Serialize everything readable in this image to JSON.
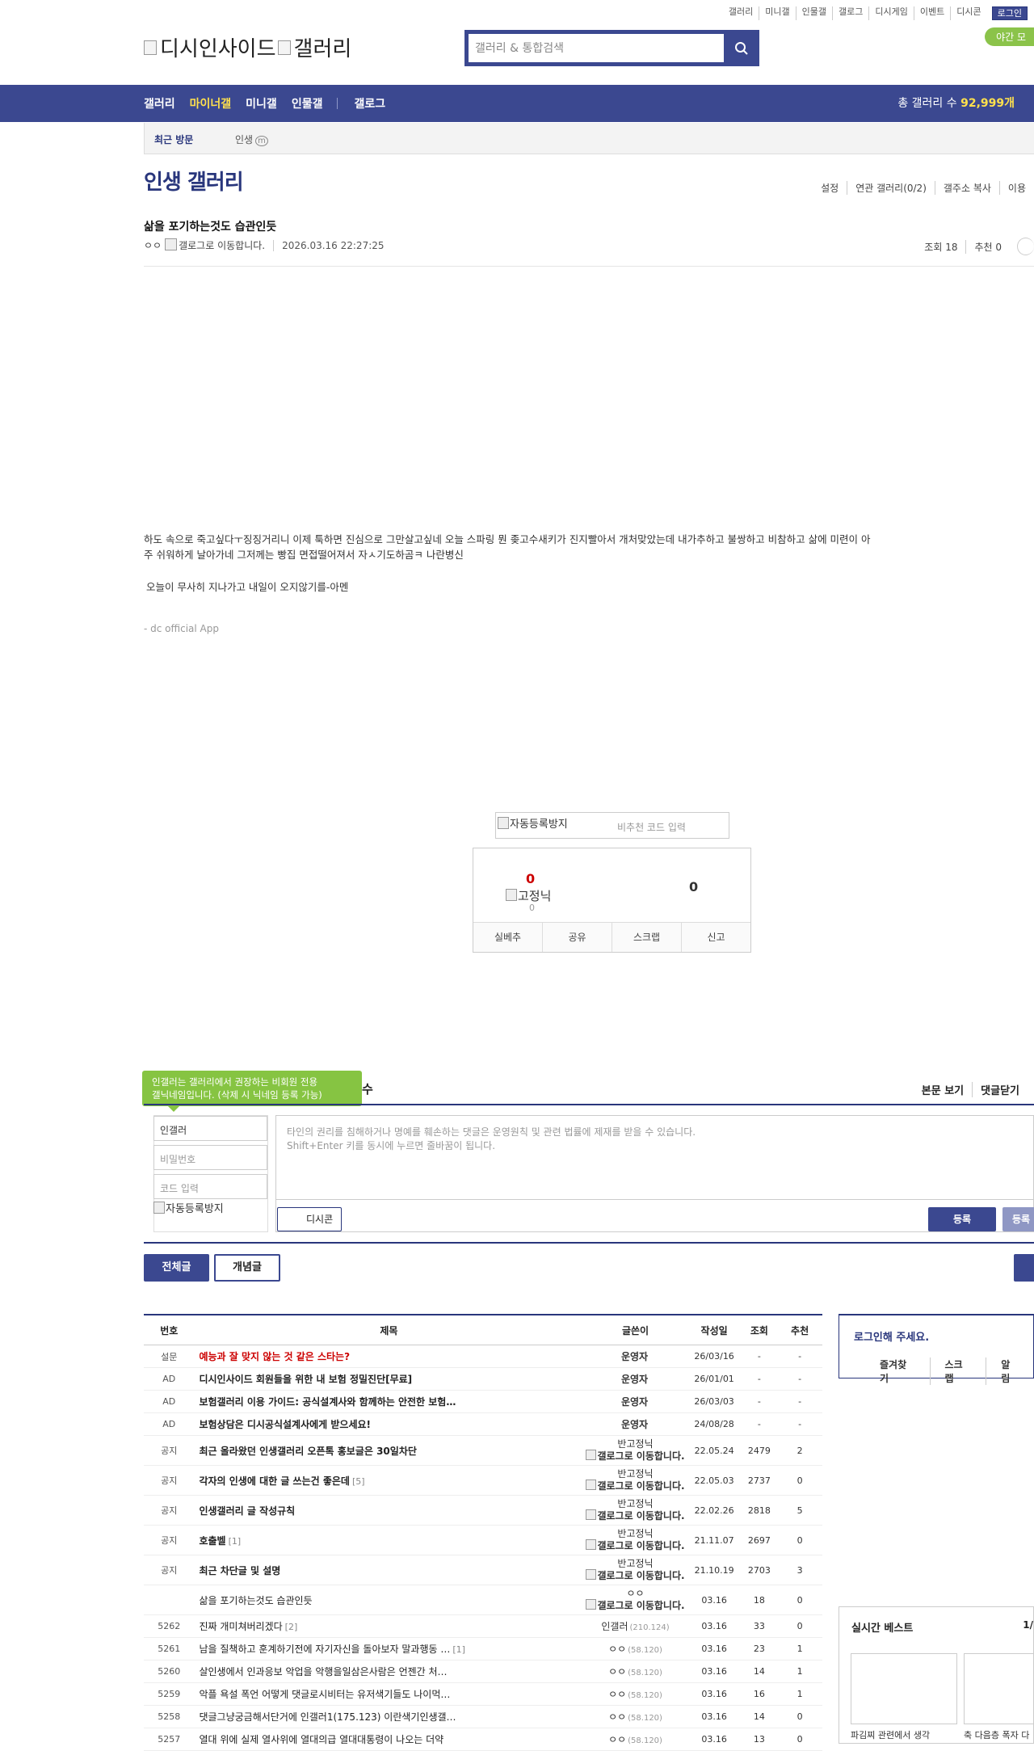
{
  "util_links": [
    "갤러리",
    "미니갤",
    "인물갤",
    "갤로그",
    "디시게임",
    "이벤트",
    "디시콘"
  ],
  "login": "로그인",
  "night_mode": "야간 모",
  "logo": {
    "brand": "디시인사이드",
    "section": "갤러리"
  },
  "search": {
    "placeholder": "갤러리 & 통합검색"
  },
  "nav": {
    "items": [
      "갤러리",
      "마이너갤",
      "미니갤",
      "인물갤",
      "갤로그"
    ],
    "total_label": "총 갤러리 수",
    "total_count": "92,999개"
  },
  "recent": {
    "label": "최근 방문",
    "item": "인생",
    "badge": "m"
  },
  "gallery": {
    "title": "인생 갤러리",
    "menu": [
      "설정",
      "연관 갤러리(0/2)",
      "갤주소 복사",
      "이용"
    ]
  },
  "post": {
    "title": "삶을 포기하는것도 습관인듯",
    "author": "ㅇㅇ",
    "gallog_alt": "갤로그로 이동합니다.",
    "date": "2026.03.16 22:27:25",
    "views": "조회 18",
    "recommend": "추천 0",
    "body1": "하도 속으로 죽고싶다ㅜ징징거리니 이제 툭하면 진심으로 그만살고싶네 오늘 스파링 뭔 좆고수새키가 진지빨아서 개처맞았는데 내가추하고 불쌍하고 비참하고 삶에 미련이 아주 쉬워하게 날아가네 그저께는 빵집 면접떨어져서 자ㅅ기도하곰ㅋ 나란병신",
    "body2": "오늘이 무사히 지나가고 내일이 오지않기를-아멘",
    "signature": "- dc official App"
  },
  "captcha": {
    "img_alt": "자동등록방지",
    "placeholder": "비추천 코드 입력"
  },
  "vote": {
    "up": "0",
    "fixed_nick_alt": "고정닉",
    "fixed_count": "0",
    "down": "0",
    "actions": [
      "실베추",
      "공유",
      "스크랩",
      "신고"
    ]
  },
  "comment": {
    "tooltip_line1": "인갤러는 갤러리에서 권장하는 비회원 전용",
    "tooltip_line2": "갤닉네임입니다. (삭제 시 닉네임 등록 가능)",
    "tooltip_tail": "수",
    "links": [
      "본문 보기",
      "댓글닫기"
    ],
    "nick_value": "인갤러",
    "password_placeholder": "비밀번호",
    "code_placeholder": "코드 입력",
    "captcha_alt": "자동등록방지",
    "notice1": "타인의 권리를 침해하거나 명예를 훼손하는 댓글은 운영원칙 및 관련 법률에 제재를 받을 수 있습니다.",
    "notice2": "Shift+Enter 키를 동시에 누르면 줄바꿈이 됩니다.",
    "dccon": "디시콘",
    "submit": "등록",
    "submit2": "등록"
  },
  "tabs": {
    "all": "전체글",
    "concept": "개념글"
  },
  "list": {
    "headers": [
      "번호",
      "제목",
      "글쓴이",
      "작성일",
      "조회",
      "추천"
    ],
    "rows": [
      {
        "num": "설문",
        "title": "예능과 잘 맞지 않는 것 같은 스타는?",
        "cmt": "",
        "writer": "운영자",
        "ip": "",
        "date": "26/03/16",
        "views": "-",
        "rec": "-",
        "kind": "hot"
      },
      {
        "num": "AD",
        "title": "디시인사이드 회원들을 위한 내 보험 정밀진단[무료]",
        "cmt": "",
        "writer": "운영자",
        "ip": "",
        "date": "26/01/01",
        "views": "-",
        "rec": "-",
        "kind": "ad"
      },
      {
        "num": "AD",
        "title": "보험갤러리 이용 가이드: 공식설계사와 함께하는 안전한 보험…",
        "cmt": "",
        "writer": "운영자",
        "ip": "",
        "date": "26/03/03",
        "views": "-",
        "rec": "-",
        "kind": "ad"
      },
      {
        "num": "AD",
        "title": "보험상담은 디시공식설계사에게 받으세요!",
        "cmt": "",
        "writer": "운영자",
        "ip": "",
        "date": "24/08/28",
        "views": "-",
        "rec": "-",
        "kind": "ad"
      },
      {
        "num": "공지",
        "title": "최근 올라왔던 인생갤러리 오픈톡 홍보글은 30일차단",
        "cmt": "",
        "writer": "반고정닉",
        "ip": "",
        "date": "22.05.24",
        "views": "2479",
        "rec": "2",
        "kind": "notice"
      },
      {
        "num": "공지",
        "title": "각자의 인생에 대한 글 쓰는건 좋은데",
        "cmt": "[5]",
        "writer": "반고정닉",
        "ip": "",
        "date": "22.05.03",
        "views": "2737",
        "rec": "0",
        "kind": "notice"
      },
      {
        "num": "공지",
        "title": "인생갤러리 글 작성규칙",
        "cmt": "",
        "writer": "반고정닉",
        "ip": "",
        "date": "22.02.26",
        "views": "2818",
        "rec": "5",
        "kind": "notice"
      },
      {
        "num": "공지",
        "title": "호출벨",
        "cmt": "[1]",
        "writer": "반고정닉",
        "ip": "",
        "date": "21.11.07",
        "views": "2697",
        "rec": "0",
        "kind": "notice"
      },
      {
        "num": "공지",
        "title": "최근 차단글 및 설명",
        "cmt": "",
        "writer": "반고정닉",
        "ip": "",
        "date": "21.10.19",
        "views": "2703",
        "rec": "3",
        "kind": "notice"
      },
      {
        "num": "",
        "title": "삶을 포기하는것도 습관인듯",
        "cmt": "",
        "writer": "ㅇㅇ",
        "ip": "",
        "date": "03.16",
        "views": "18",
        "rec": "0",
        "kind": "current"
      },
      {
        "num": "5262",
        "title": "진짜 개미쳐버리겠다",
        "cmt": "[2]",
        "writer": "인갤러",
        "ip": "(210.124)",
        "date": "03.16",
        "views": "33",
        "rec": "0",
        "kind": "normal"
      },
      {
        "num": "5261",
        "title": "남을 질책하고 훈계하기전에 자기자신을 돌아보자 말과행동 …",
        "cmt": "[1]",
        "writer": "ㅇㅇ",
        "ip": "(58.120)",
        "date": "03.16",
        "views": "23",
        "rec": "1",
        "kind": "normal"
      },
      {
        "num": "5260",
        "title": "살인생에서 인과응보 악업을 악행을일삼은사람은 언젠간 처…",
        "cmt": "",
        "writer": "ㅇㅇ",
        "ip": "(58.120)",
        "date": "03.16",
        "views": "14",
        "rec": "1",
        "kind": "normal"
      },
      {
        "num": "5259",
        "title": "악플 욕설 폭언 어떻게 댓글로시비터는 유저색기들도 나이먹…",
        "cmt": "",
        "writer": "ㅇㅇ",
        "ip": "(58.120)",
        "date": "03.16",
        "views": "16",
        "rec": "1",
        "kind": "normal"
      },
      {
        "num": "5258",
        "title": "댓글그냥궁금해서단거에 인갤러1(175.123) 이란색기인생갤…",
        "cmt": "",
        "writer": "ㅇㅇ",
        "ip": "(58.120)",
        "date": "03.16",
        "views": "14",
        "rec": "0",
        "kind": "normal"
      },
      {
        "num": "5257",
        "title": "열대 위에 실제 열사위에 열대의급 열대대통령이 나오는 더약",
        "cmt": "",
        "writer": "ㅇㅇ",
        "ip": "(58.120)",
        "date": "03.16",
        "views": "13",
        "rec": "0",
        "kind": "normal"
      }
    ]
  },
  "loginbox": {
    "title": "로그인해 주세요.",
    "actions": [
      "즐겨찾기",
      "스크랩",
      "알림"
    ]
  },
  "best": {
    "title": "실시간 베스트",
    "page": "1/",
    "caption1": "파김찌 관련에서 생각",
    "caption2": "축 다음층 폭자 다"
  }
}
